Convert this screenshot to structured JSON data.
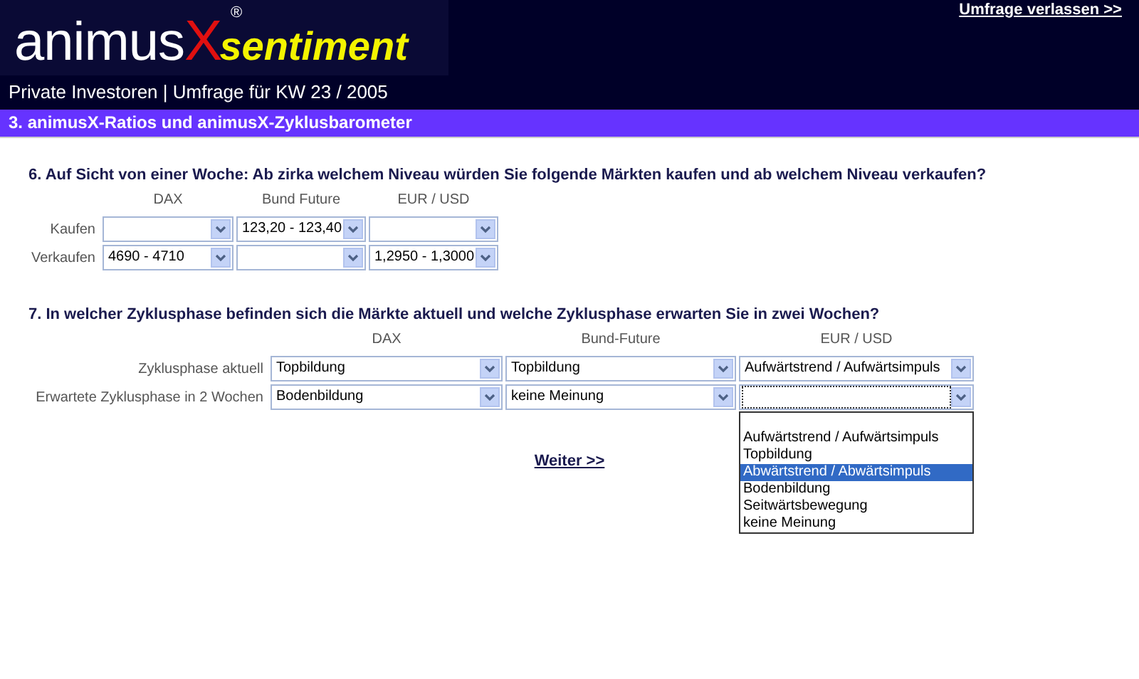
{
  "header": {
    "logo": {
      "brand": "animus",
      "mark": "X",
      "product": "sentiment",
      "registered": "®"
    },
    "exit_link": "Umfrage verlassen >>",
    "subtitle": "Private Investoren | Umfrage für KW 23 / 2005"
  },
  "section_title": "3. animusX-Ratios und animusX-Zyklusbarometer",
  "question_6": {
    "text": "6. Auf Sicht von einer Woche: Ab zirka welchem Niveau würden Sie folgende Märkten kaufen und ab welchem Niveau verkaufen?",
    "columns": [
      "DAX",
      "Bund Future",
      "EUR / USD"
    ],
    "rows": [
      {
        "label": "Kaufen",
        "cells": [
          {
            "focused": false
          },
          {
            "value": "123,20 - 123,40",
            "focused": false
          },
          {
            "focused": false
          }
        ]
      },
      {
        "label": "Verkaufen",
        "cells": [
          {
            "value": "4690 - 4710",
            "focused": false
          },
          {
            "focused": false
          },
          {
            "value": "1,2950 - 1,3000",
            "focused": false
          }
        ]
      }
    ]
  },
  "question_7": {
    "text": "7. In welcher Zyklusphase befinden sich die Märkte aktuell und welche Zyklusphase erwarten Sie in zwei Wochen?",
    "columns": [
      "DAX",
      "Bund-Future",
      "EUR / USD"
    ],
    "rows": [
      {
        "label": "Zyklusphase aktuell",
        "cells": [
          {
            "value": "Topbildung",
            "focused": false
          },
          {
            "value": "Topbildung",
            "focused": false
          },
          {
            "value": "Aufwärtstrend / Aufwärtsimpuls",
            "focused": false
          }
        ]
      },
      {
        "label": "Erwartete Zyklusphase in 2 Wochen",
        "cells": [
          {
            "value": "Bodenbildung",
            "focused": false
          },
          {
            "value": "keine Meinung",
            "focused": false
          },
          {
            "focused": true,
            "open": true,
            "options": [
              {
                "label": "Aufwärtstrend / Aufwärtsimpuls",
                "selected": false
              },
              {
                "label": "Topbildung",
                "selected": false
              },
              {
                "label": "Abwärtstrend / Abwärtsimpuls",
                "selected": true
              },
              {
                "label": "Bodenbildung",
                "selected": false
              },
              {
                "label": "Seitwärtsbewegung",
                "selected": false
              },
              {
                "label": "keine Meinung",
                "selected": false
              }
            ]
          }
        ]
      }
    ]
  },
  "next_link": "Weiter >>"
}
